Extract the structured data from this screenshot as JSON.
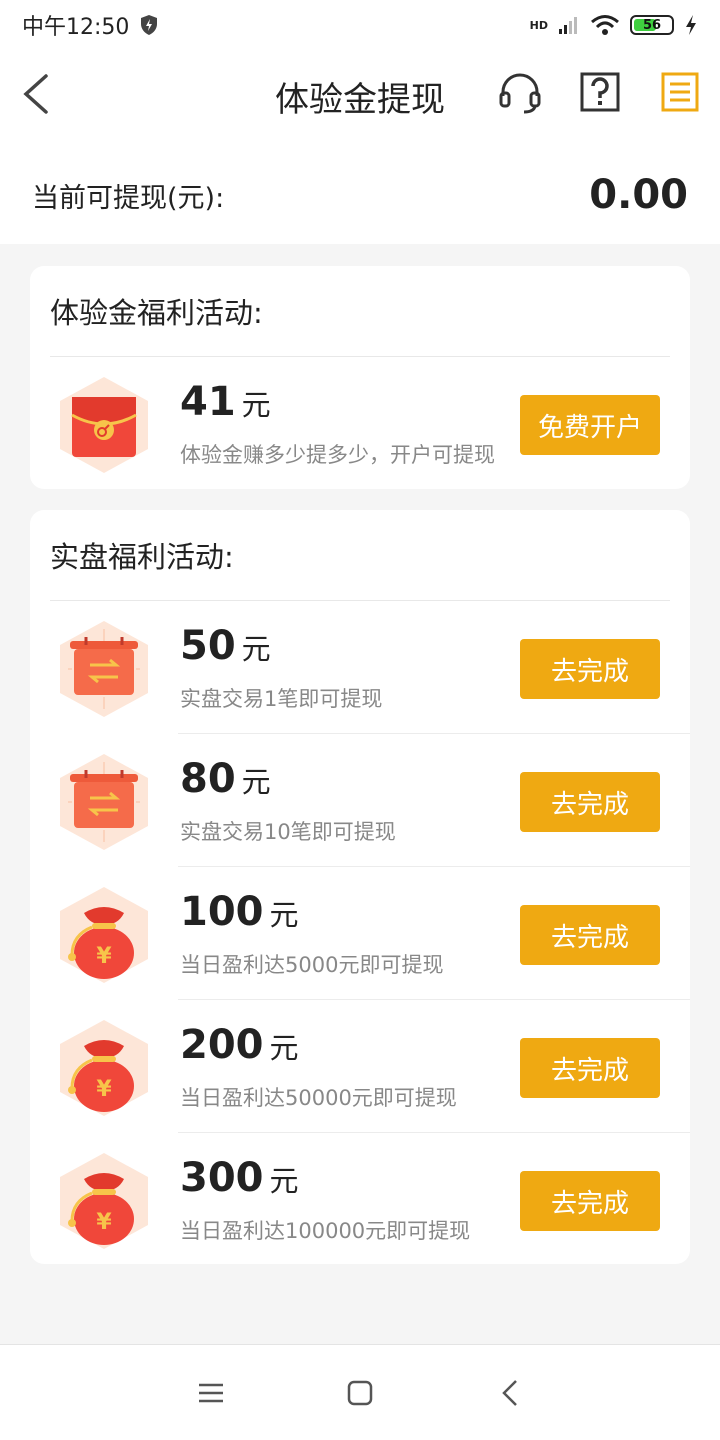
{
  "status_bar": {
    "time": "中午12:50",
    "network_label": "HD",
    "battery": "56"
  },
  "header": {
    "title": "体验金提现"
  },
  "balance": {
    "label": "当前可提现(元):",
    "value": "0.00"
  },
  "trial_section": {
    "title": "体验金福利活动:",
    "items": [
      {
        "amount": "41",
        "unit": "元",
        "desc": "体验金赚多少提多少，开户可提现",
        "button": "免费开户",
        "icon": "red-envelope-icon"
      }
    ]
  },
  "live_section": {
    "title": "实盘福利活动:",
    "items": [
      {
        "amount": "50",
        "unit": "元",
        "desc": "实盘交易1笔即可提现",
        "button": "去完成",
        "icon": "trade-board-icon"
      },
      {
        "amount": "80",
        "unit": "元",
        "desc": "实盘交易10笔即可提现",
        "button": "去完成",
        "icon": "trade-board-icon"
      },
      {
        "amount": "100",
        "unit": "元",
        "desc": "当日盈利达5000元即可提现",
        "button": "去完成",
        "icon": "money-bag-icon"
      },
      {
        "amount": "200",
        "unit": "元",
        "desc": "当日盈利达50000元即可提现",
        "button": "去完成",
        "icon": "money-bag-icon"
      },
      {
        "amount": "300",
        "unit": "元",
        "desc": "当日盈利达100000元即可提现",
        "button": "去完成",
        "icon": "money-bag-icon"
      }
    ]
  },
  "colors": {
    "accent": "#efa912",
    "envelope_red": "#f0473a"
  }
}
